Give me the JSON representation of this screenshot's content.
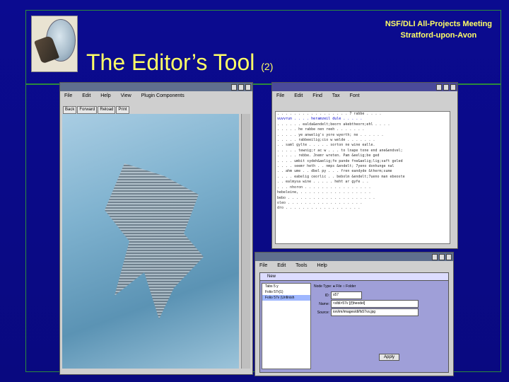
{
  "slide": {
    "meeting_line1": "NSF/DLI All-Projects Meeting",
    "meeting_line2": "Stratford-upon-Avon",
    "title": "The Editor’s Tool",
    "title_suffix": "(2)"
  },
  "browser": {
    "menu": [
      "File",
      "Edit",
      "Help",
      "View",
      "Plugin Components"
    ],
    "toolbar": [
      "Back",
      "Forward",
      "Reload",
      "Print"
    ]
  },
  "transcript": {
    "menu": [
      "File",
      "Edit",
      "Find",
      "Tax",
      "Font"
    ],
    "lines": [
      ". . . . . . . . . . . . . . . . . 7 rabbe . . . .",
      "vuvvrun . . . . heramzeil dule . . . . .",
      ". . . . . . ealda&endelt;beorn akebtheorn;ehl . . . .",
      ". . . . . he rabbe nen reeh . . . . . . .",
      ". . . . . ye anwelig's yore wyerth; ne . . . . . .",
      ". . . . . rabbeeilig;cio w welde . . . . . . .",
      ". . saml gylte . . . . . sorton ne wine ealle.",
      ". . . . . tewnig;r ac w . . . to lnape tone end ane&endvel;",
      ". . . . . rebbe. Jnemr wreten. Pam &eelig;be ged",
      ". . . . umbit sydeh&aelig;fe pande fne&aelig;lig;saft geled",
      ". . . . seemr heth . . nmps &endelt; 7yeno donhunge nal",
      ". . ahm ume . . dbel py . . . fren eandyde &therm;sume",
      ". . . . eabelig ceorlic . . bebolm &endelt;7ueno man ebeoste",
      ". . ealmysa wine . . . . . heht ar gyfe . .",
      ". . . nhoron . . . . . . . . . . . . . . . .",
      "hebeleine, . . . . . . . . . . . . . . . . .",
      "bebo . . . . . . . . . . . . . . . . . . . . .",
      "oleo . . . . . . . . . . . . . . . . . .",
      "dro . . . . . . . . . . . . . . . . . ."
    ]
  },
  "editor": {
    "menu": [
      "File",
      "Edit",
      "Tools",
      "Help"
    ],
    "panel_title": "New",
    "node_type_label": "Node Type:",
    "radio_file": "File",
    "radio_folder": "Folder",
    "tree_items": [
      "Tabs 5 y",
      "Folio 57r(1)",
      "Folio 57v (Unfinish"
    ],
    "id_label": "ID:",
    "id_value": "s57",
    "name_label": "Name:",
    "name_value": "<vlbl>57v [(f)heodel]",
    "source_label": "Source:",
    "source_value": "ion/im/images/dl/fs57vs.jpg",
    "apply_label": "Apply"
  }
}
